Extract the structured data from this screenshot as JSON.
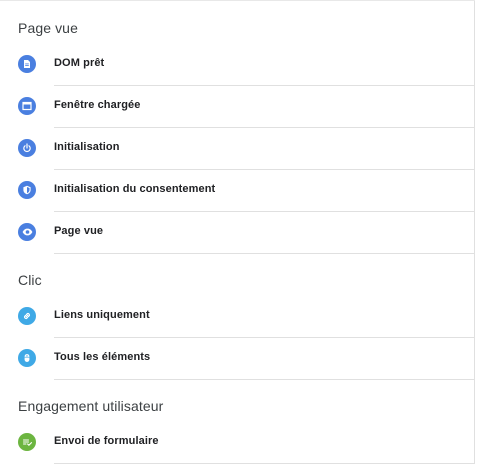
{
  "sections": [
    {
      "title": "Page vue",
      "items": [
        {
          "label": "DOM prêt",
          "icon": "document-icon",
          "color": "#4a7fe0"
        },
        {
          "label": "Fenêtre chargée",
          "icon": "window-icon",
          "color": "#4a7fe0"
        },
        {
          "label": "Initialisation",
          "icon": "power-icon",
          "color": "#4a7fe0"
        },
        {
          "label": "Initialisation du consentement",
          "icon": "shield-icon",
          "color": "#4a7fe0"
        },
        {
          "label": "Page vue",
          "icon": "eye-icon",
          "color": "#4a7fe0"
        }
      ]
    },
    {
      "title": "Clic",
      "items": [
        {
          "label": "Liens uniquement",
          "icon": "link-icon",
          "color": "#3fa9e6"
        },
        {
          "label": "Tous les éléments",
          "icon": "mouse-icon",
          "color": "#3fa9e6"
        }
      ]
    },
    {
      "title": "Engagement utilisateur",
      "items": [
        {
          "label": "Envoi de formulaire",
          "icon": "form-check-icon",
          "color": "#6cb540"
        }
      ]
    }
  ]
}
